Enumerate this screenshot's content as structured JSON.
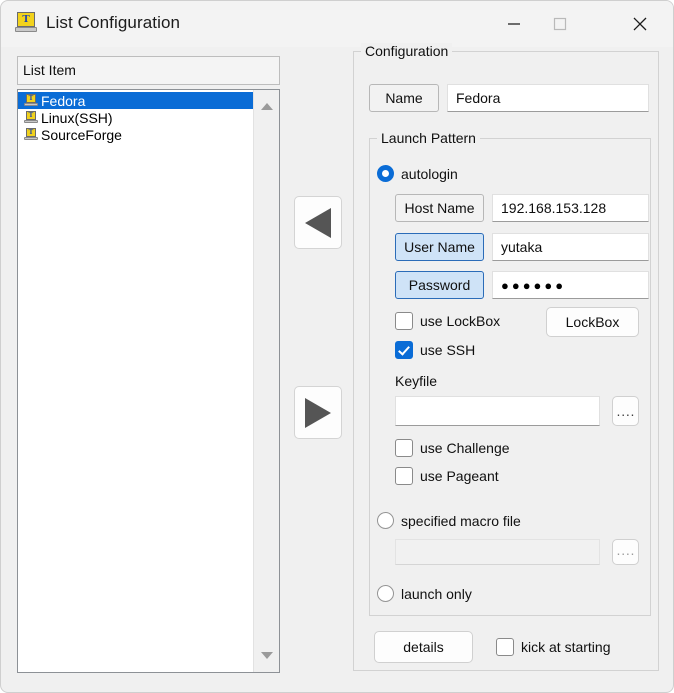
{
  "window": {
    "title": "List Configuration",
    "icon": "teraterm-icon",
    "icon_letter": "T",
    "controls": {
      "minimize": "—",
      "maximize": "□",
      "close": "✕"
    }
  },
  "left_panel": {
    "header_label": "List Item",
    "items": [
      {
        "label": "Fedora",
        "icon": "teraterm-icon",
        "icon_letter": "T",
        "selected": true
      },
      {
        "label": "Linux(SSH)",
        "icon": "teraterm-icon",
        "icon_letter": "T",
        "selected": false
      },
      {
        "label": "SourceForge",
        "icon": "teraterm-icon",
        "icon_letter": "T",
        "selected": false
      }
    ],
    "scrollbar": {
      "up_icon": "triangle-up-icon",
      "down_icon": "triangle-down-icon"
    }
  },
  "transfer_buttons": {
    "move_left": "triangle-left-icon",
    "move_right": "triangle-right-icon"
  },
  "configuration": {
    "group_title": "Configuration",
    "name_label": "Name",
    "name_value": "Fedora",
    "launch_pattern": {
      "group_title": "Launch Pattern",
      "autologin": {
        "label": "autologin",
        "selected": true,
        "host_label": "Host Name",
        "host_value": "192.168.153.128",
        "user_label": "User Name",
        "user_value": "yutaka",
        "password_label": "Password",
        "password_value": "●●●●●●",
        "use_lockbox_label": "use LockBox",
        "use_lockbox_checked": false,
        "lockbox_button": "LockBox",
        "use_ssh_label": "use SSH",
        "use_ssh_checked": true,
        "keyfile_label": "Keyfile",
        "keyfile_value": "",
        "keyfile_browse": "····",
        "use_challenge_label": "use Challenge",
        "use_challenge_checked": false,
        "use_pageant_label": "use Pageant",
        "use_pageant_checked": false
      },
      "macro": {
        "label": "specified macro file",
        "selected": false,
        "file_value": "",
        "browse": "····"
      },
      "launch_only": {
        "label": "launch only",
        "selected": false
      }
    },
    "details_button": "details",
    "kick_label": "kick at starting",
    "kick_checked": false
  },
  "colors": {
    "accent": "#0a6cd6",
    "selection": "#0a6cd6",
    "window_bg": "#f0f0f0",
    "icon_screen": "#f2d21c",
    "icon_letter": "#1a3fb0"
  }
}
